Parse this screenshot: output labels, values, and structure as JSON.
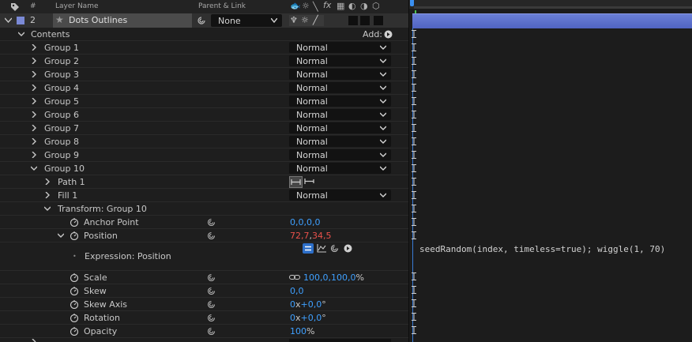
{
  "header": {
    "col_number": "#",
    "col_layer_name": "Layer Name",
    "col_parent": "Parent & Link",
    "col_switches_fx": "fx"
  },
  "layer": {
    "number": "2",
    "name": "Dots Outlines",
    "parent_value": "None"
  },
  "contents": {
    "label": "Contents",
    "add_label": "Add:"
  },
  "groups": [
    {
      "label": "Group 1",
      "blend": "Normal"
    },
    {
      "label": "Group 2",
      "blend": "Normal"
    },
    {
      "label": "Group 3",
      "blend": "Normal"
    },
    {
      "label": "Group 4",
      "blend": "Normal"
    },
    {
      "label": "Group 5",
      "blend": "Normal"
    },
    {
      "label": "Group 6",
      "blend": "Normal"
    },
    {
      "label": "Group 7",
      "blend": "Normal"
    },
    {
      "label": "Group 8",
      "blend": "Normal"
    },
    {
      "label": "Group 9",
      "blend": "Normal"
    },
    {
      "label": "Group 10",
      "blend": "Normal"
    }
  ],
  "path": {
    "label": "Path 1"
  },
  "fill": {
    "label": "Fill 1",
    "blend": "Normal"
  },
  "transform": {
    "label": "Transform: Group 10",
    "anchor": {
      "label": "Anchor Point",
      "v1": "0,0",
      "sep": ",",
      "v2": "0,0"
    },
    "position": {
      "label": "Position",
      "v1": "72,7",
      "sep": ",",
      "v2": "34,5"
    },
    "expression_label": "Expression: Position",
    "scale": {
      "label": "Scale",
      "v1": "100,0",
      "sep": ",",
      "v2": "100,0",
      "unit": "%"
    },
    "skew": {
      "label": "Skew",
      "value": "0,0"
    },
    "skew_axis": {
      "label": "Skew Axis",
      "v1": "0",
      "x": "x",
      "v2": "+0,0",
      "unit": "°"
    },
    "rotation": {
      "label": "Rotation",
      "v1": "0",
      "x": "x",
      "v2": "+0,0",
      "unit": "°"
    },
    "opacity": {
      "label": "Opacity",
      "value": "100",
      "unit": "%"
    }
  },
  "expression_code": "seedRandom(index, timeless=true); wiggle(1, 70)",
  "colors": {
    "value_blue": "#3fa0ff",
    "value_red": "#e9514b",
    "layer_bar": "#5a6fd0",
    "label_swatch": "#7b8ad6"
  }
}
